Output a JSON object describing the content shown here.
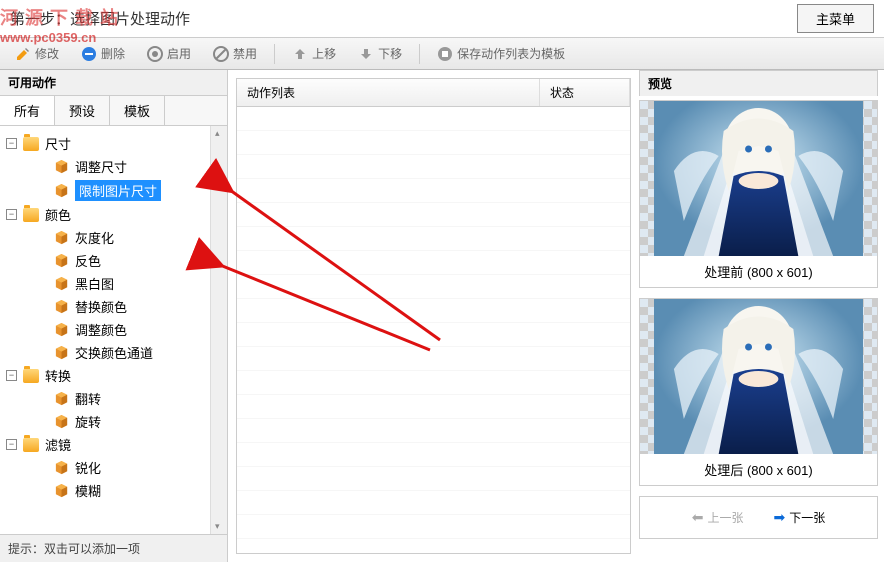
{
  "header": {
    "title": "第一步：选择图片处理动作",
    "main_menu": "主菜单",
    "watermark": "河源下载站\nwww.pc0359.cn"
  },
  "toolbar": {
    "edit": "修改",
    "delete": "删除",
    "enable": "启用",
    "disable": "禁用",
    "move_up": "上移",
    "move_down": "下移",
    "save_template": "保存动作列表为模板"
  },
  "left": {
    "title": "可用动作",
    "tabs": [
      "所有",
      "预设",
      "模板"
    ],
    "tree": [
      {
        "type": "folder",
        "label": "尺寸",
        "expanded": true,
        "children": [
          {
            "label": "调整尺寸"
          },
          {
            "label": "限制图片尺寸",
            "selected": true
          }
        ]
      },
      {
        "type": "folder",
        "label": "颜色",
        "expanded": true,
        "children": [
          {
            "label": "灰度化"
          },
          {
            "label": "反色"
          },
          {
            "label": "黑白图"
          },
          {
            "label": "替换颜色"
          },
          {
            "label": "调整颜色"
          },
          {
            "label": "交换颜色通道"
          }
        ]
      },
      {
        "type": "folder",
        "label": "转换",
        "expanded": true,
        "children": [
          {
            "label": "翻转"
          },
          {
            "label": "旋转"
          }
        ]
      },
      {
        "type": "folder",
        "label": "滤镜",
        "expanded": true,
        "children": [
          {
            "label": "锐化"
          },
          {
            "label": "模糊"
          }
        ]
      }
    ],
    "hint": "提示：双击可以添加一项"
  },
  "center": {
    "col_action": "动作列表",
    "col_status": "状态"
  },
  "right": {
    "title": "预览",
    "before": "处理前",
    "after": "处理后",
    "dims": "(800 x 601)",
    "prev": "上一张",
    "next": "下一张"
  }
}
